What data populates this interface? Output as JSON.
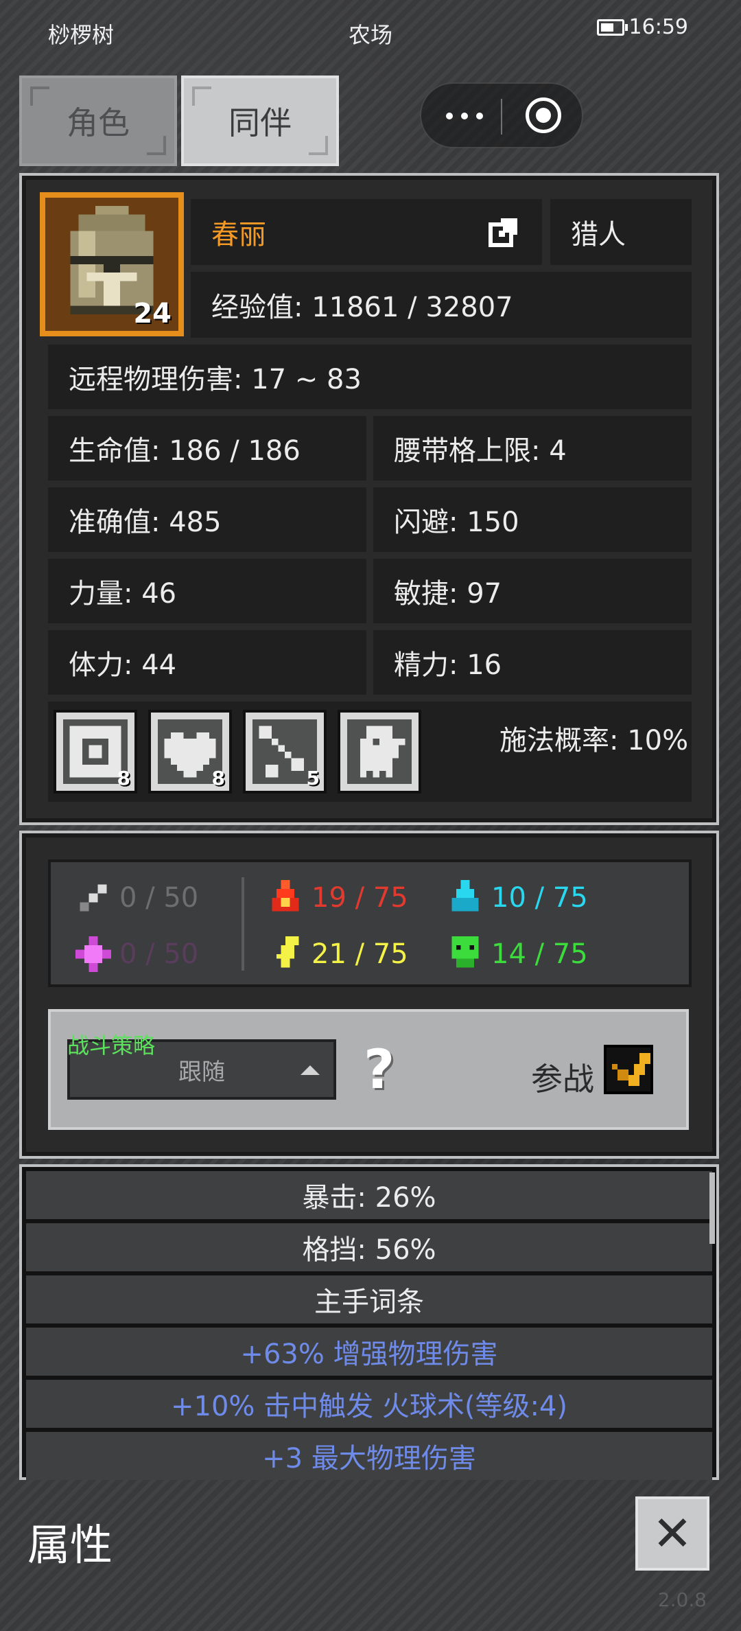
{
  "status_bar": {
    "left": "桫椤树",
    "center": "农场",
    "time": "16:59"
  },
  "tabs": [
    {
      "label": "角色"
    },
    {
      "label": "同伴"
    }
  ],
  "character": {
    "name": "春丽",
    "class": "猎人",
    "level": "24",
    "exp": "经验值: 11861 / 32807",
    "damage": "远程物理伤害: 17 ~ 83",
    "stats": {
      "hp": "生命值: 186 / 186",
      "belt": "腰带格上限: 4",
      "accuracy": "准确值: 485",
      "dodge": "闪避: 150",
      "strength": "力量: 46",
      "agility": "敏捷: 97",
      "stamina": "体力: 44",
      "energy": "精力: 16"
    },
    "cast_rate": "施法概率: 10%",
    "skills": [
      {
        "count": "8"
      },
      {
        "count": "8"
      },
      {
        "count": "5"
      },
      {
        "count": ""
      }
    ]
  },
  "resistances": {
    "physical": "0 / 50",
    "magic": "0 / 50",
    "fire": "19 / 75",
    "lightning": "21 / 75",
    "cold": "10 / 75",
    "poison": "14 / 75",
    "colors": {
      "fire": "#e23a2f",
      "lightning": "#f4f247",
      "cold": "#29d8ee",
      "poison": "#3ddc3d",
      "muted": "#6e6e70",
      "magic": "#5a3d5c"
    }
  },
  "strategy": {
    "label": "战斗策略",
    "selected": "跟随",
    "help": "?",
    "join_label": "参战"
  },
  "attributes_list": [
    {
      "text": "暴击: 26%",
      "style": "white"
    },
    {
      "text": "格挡: 56%",
      "style": "white"
    },
    {
      "text": "主手词条",
      "style": "white"
    },
    {
      "text": "+63% 增强物理伤害",
      "style": "blue"
    },
    {
      "text": "+10% 击中触发 火球术(等级:4)",
      "style": "blue"
    },
    {
      "text": "+3 最大物理伤害",
      "style": "blue"
    }
  ],
  "footer": {
    "title": "属性",
    "version": "2.0.8"
  }
}
